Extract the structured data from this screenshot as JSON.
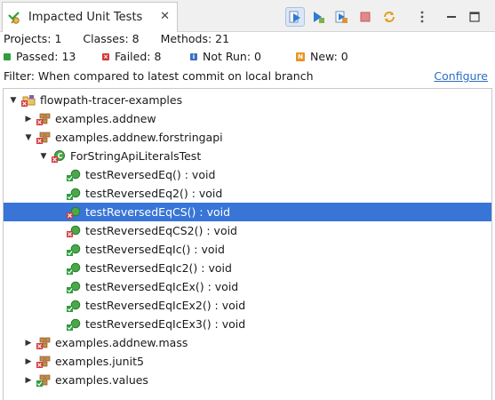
{
  "tab": {
    "title": "Impacted Unit Tests",
    "close_glyph": "✕"
  },
  "toolbar": {
    "buttons": [
      {
        "name": "run-impacted-tests-button",
        "icon": "run-icon",
        "active": true
      },
      {
        "name": "run-all-button",
        "icon": "run-all-icon",
        "active": false
      },
      {
        "name": "rerun-button",
        "icon": "rerun-icon",
        "active": false
      },
      {
        "name": "stop-button",
        "icon": "stop-icon",
        "active": false
      },
      {
        "name": "sync-button",
        "icon": "sync-icon",
        "active": false
      },
      {
        "name": "view-menu-button",
        "icon": "kebab-menu-icon",
        "active": false
      },
      {
        "name": "minimize-button",
        "icon": "minimize-icon",
        "active": false
      },
      {
        "name": "maximize-button",
        "icon": "maximize-icon",
        "active": false
      }
    ]
  },
  "summary": {
    "projects": "Projects: 1",
    "classes": "Classes: 8",
    "methods": "Methods: 21"
  },
  "stats": {
    "passed": "Passed: 13",
    "failed": "Failed: 8",
    "not_run": "Not Run: 0",
    "new": "New: 0"
  },
  "filter": {
    "text": "Filter: When compared to latest commit on local branch",
    "configure_label": "Configure"
  },
  "colors": {
    "selection": "#3875d7",
    "passed": "#2e9e3e",
    "failed": "#d23a3a",
    "not_run": "#3c6fc2",
    "new": "#e8952a",
    "link": "#2a6ec7"
  },
  "tree": [
    {
      "label": "flowpath-tracer-examples",
      "depth": 0,
      "twisty": "expanded",
      "icon": "project-icon",
      "status": "failed",
      "selected": false
    },
    {
      "label": "examples.addnew",
      "depth": 1,
      "twisty": "collapsed",
      "icon": "package-icon",
      "status": "failed",
      "selected": false
    },
    {
      "label": "examples.addnew.forstringapi",
      "depth": 1,
      "twisty": "expanded",
      "icon": "package-icon",
      "status": "failed",
      "selected": false
    },
    {
      "label": "ForStringApiLiteralsTest",
      "depth": 2,
      "twisty": "expanded",
      "icon": "test-class-icon",
      "status": "failed",
      "selected": false
    },
    {
      "label": "testReversedEq() : void",
      "depth": 3,
      "twisty": "none",
      "icon": "test-method-icon",
      "status": "passed",
      "selected": false
    },
    {
      "label": "testReversedEq2() : void",
      "depth": 3,
      "twisty": "none",
      "icon": "test-method-icon",
      "status": "passed",
      "selected": false
    },
    {
      "label": "testReversedEqCS() : void",
      "depth": 3,
      "twisty": "none",
      "icon": "test-method-icon",
      "status": "failed",
      "selected": true
    },
    {
      "label": "testReversedEqCS2() : void",
      "depth": 3,
      "twisty": "none",
      "icon": "test-method-icon",
      "status": "failed",
      "selected": false
    },
    {
      "label": "testReversedEqIc() : void",
      "depth": 3,
      "twisty": "none",
      "icon": "test-method-icon",
      "status": "passed",
      "selected": false
    },
    {
      "label": "testReversedEqIc2() : void",
      "depth": 3,
      "twisty": "none",
      "icon": "test-method-icon",
      "status": "passed",
      "selected": false
    },
    {
      "label": "testReversedEqIcEx() : void",
      "depth": 3,
      "twisty": "none",
      "icon": "test-method-icon",
      "status": "passed",
      "selected": false
    },
    {
      "label": "testReversedEqIcEx2() : void",
      "depth": 3,
      "twisty": "none",
      "icon": "test-method-icon",
      "status": "passed",
      "selected": false
    },
    {
      "label": "testReversedEqIcEx3() : void",
      "depth": 3,
      "twisty": "none",
      "icon": "test-method-icon",
      "status": "passed",
      "selected": false
    },
    {
      "label": "examples.addnew.mass",
      "depth": 1,
      "twisty": "collapsed",
      "icon": "package-icon",
      "status": "failed",
      "selected": false
    },
    {
      "label": "examples.junit5",
      "depth": 1,
      "twisty": "collapsed",
      "icon": "package-icon",
      "status": "failed",
      "selected": false
    },
    {
      "label": "examples.values",
      "depth": 1,
      "twisty": "collapsed",
      "icon": "package-icon",
      "status": "passed",
      "selected": false
    }
  ]
}
